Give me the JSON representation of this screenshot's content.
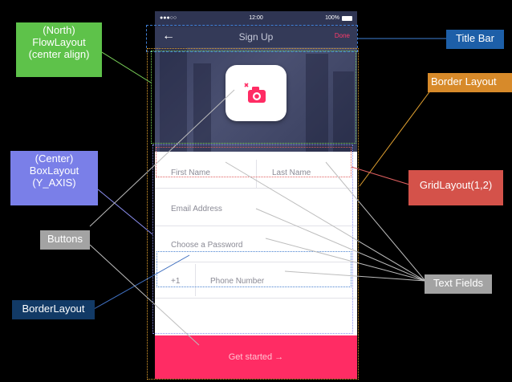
{
  "phone": {
    "status_time": "12:00",
    "status_battery": "100%",
    "status_carrier": "●●●○○",
    "title": "Sign Up",
    "done_label": "Done",
    "back_glyph": "←",
    "fields": {
      "first_name": "First Name",
      "last_name": "Last Name",
      "email": "Email Address",
      "password": "Choose a Password",
      "country_code": "+1",
      "phone": "Phone Number"
    },
    "cta_label": "Get started →"
  },
  "annotations": {
    "north_flow": "(North) FlowLayout (center align)",
    "center_box": "(Center) BoxLayout (Y_AXIS)",
    "buttons": "Buttons",
    "border_layout_left": "BorderLayout",
    "title_bar": "Title Bar",
    "border_layout_right": "Border Layout",
    "grid_layout": "GridLayout(1,2)",
    "text_fields": "Text Fields"
  },
  "colors": {
    "cta": "#ff2c64",
    "titlebar": "#343a58",
    "title_bar_label": "#1d5fa8",
    "north_label": "#5ec24a",
    "center_label": "#7a7fe8",
    "gray_label": "#a3a3a3",
    "border_label_left": "#123a66",
    "border_label_right": "#d78a2a",
    "grid_label": "#d4524a"
  }
}
